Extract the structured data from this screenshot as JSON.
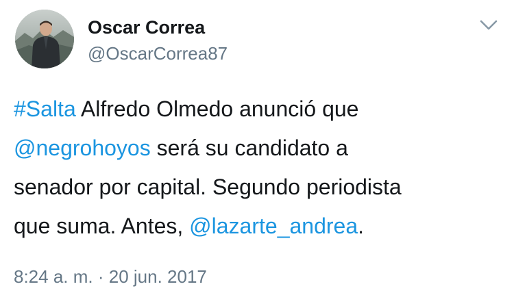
{
  "user": {
    "display_name": "Oscar Correa",
    "handle": "@OscarCorrea87",
    "avatar_icon": "profile-photo"
  },
  "menu": {
    "icon": "chevron-down-icon"
  },
  "tweet": {
    "line1": {
      "hashtag": "#Salta",
      "text": " Alfredo Olmedo anunció que"
    },
    "line2": {
      "mention": "@negrohoyos",
      "text": " será su candidato a"
    },
    "line3": {
      "text": "senador por capital. Segundo periodista"
    },
    "line4": {
      "text_before": "que suma. Antes, ",
      "mention": "@lazarte_andrea",
      "text_after": "."
    },
    "time": "8:24 a. m.",
    "separator": " · ",
    "date": "20 jun. 2017"
  },
  "colors": {
    "link": "#1b95e0",
    "text": "#14171a",
    "secondary": "#657786"
  }
}
